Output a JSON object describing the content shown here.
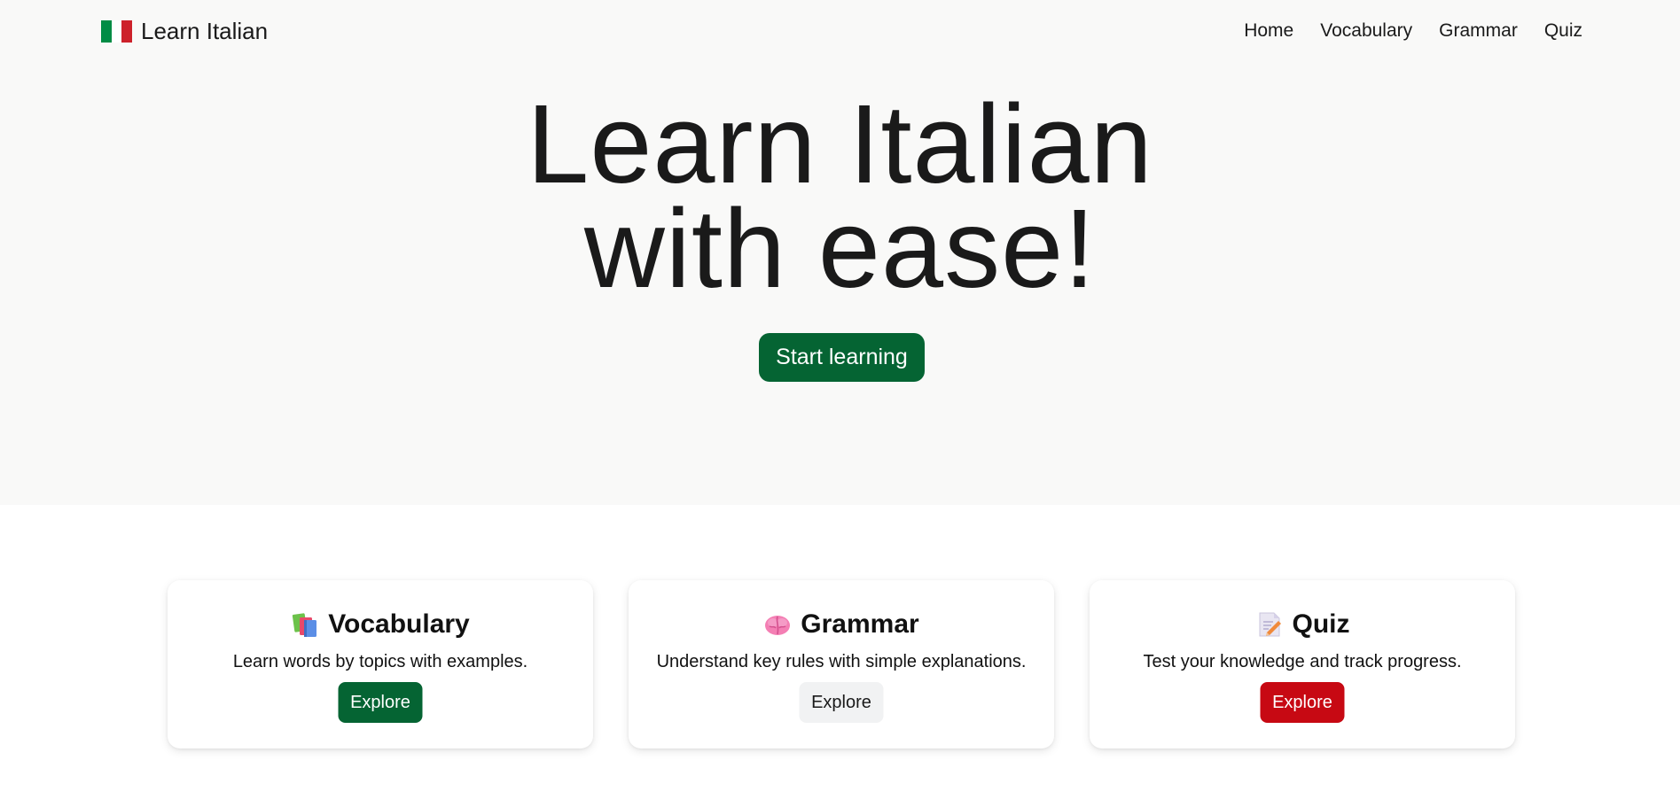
{
  "brand": {
    "name": "Learn Italian",
    "flag_colors": [
      "#008c45",
      "#ffffff",
      "#cd212a"
    ]
  },
  "nav": {
    "items": [
      {
        "label": "Home"
      },
      {
        "label": "Vocabulary"
      },
      {
        "label": "Grammar"
      },
      {
        "label": "Quiz"
      }
    ]
  },
  "hero": {
    "title_line1": "Learn Italian",
    "title_line2": "with ease!",
    "cta_label": "Start learning"
  },
  "cards": [
    {
      "icon": "books-icon",
      "title": "Vocabulary",
      "description": "Learn words by topics with examples.",
      "button_label": "Explore"
    },
    {
      "icon": "brain-icon",
      "title": "Grammar",
      "description": "Understand key rules with simple explanations.",
      "button_label": "Explore"
    },
    {
      "icon": "memo-icon",
      "title": "Quiz",
      "description": "Test your knowledge and track progress.",
      "button_label": "Explore"
    }
  ],
  "colors": {
    "accent_green": "#056433",
    "accent_red": "#c70913",
    "neutral_button": "#f1f2f3",
    "hero_background": "#f9f9f8"
  }
}
